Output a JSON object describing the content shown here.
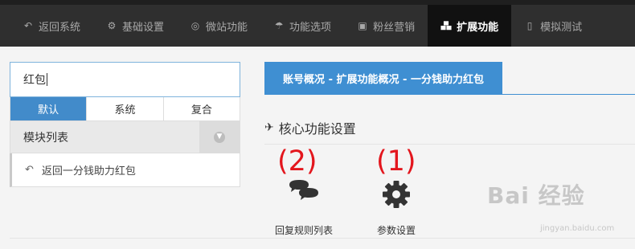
{
  "nav": {
    "items": [
      {
        "label": "返回系统",
        "icon": "return-icon"
      },
      {
        "label": "基础设置",
        "icon": "gear-icon"
      },
      {
        "label": "微站功能",
        "icon": "lifebuoy-icon"
      },
      {
        "label": "功能选项",
        "icon": "umbrella-icon"
      },
      {
        "label": "粉丝营销",
        "icon": "gift-icon"
      },
      {
        "label": "扩展功能",
        "icon": "cubes-icon",
        "active": true
      },
      {
        "label": "模拟测试",
        "icon": "mobile-icon"
      }
    ]
  },
  "sidebar": {
    "search_value": "红包",
    "tabs": [
      "默认",
      "系统",
      "复合"
    ],
    "module_header": "模块列表",
    "module_items": [
      {
        "label": "返回一分钱助力红包",
        "icon": "return-icon"
      }
    ]
  },
  "main": {
    "breadcrumb": "账号概况 - 扩展功能概况 - 一分钱助力红包",
    "section_title": "核心功能设置",
    "functions": [
      {
        "label": "回复规则列表",
        "icon": "comments-icon",
        "annotation": "(2)"
      },
      {
        "label": "参数设置",
        "icon": "cog-icon",
        "annotation": "(1)"
      }
    ]
  },
  "watermark": {
    "main": "Bai 经验",
    "sub": "jingyan.baidu.com"
  },
  "colors": {
    "nav_bg": "#2f2f2f",
    "nav_active": "#111111",
    "accent": "#428bca",
    "annotation": "#e3161d"
  }
}
